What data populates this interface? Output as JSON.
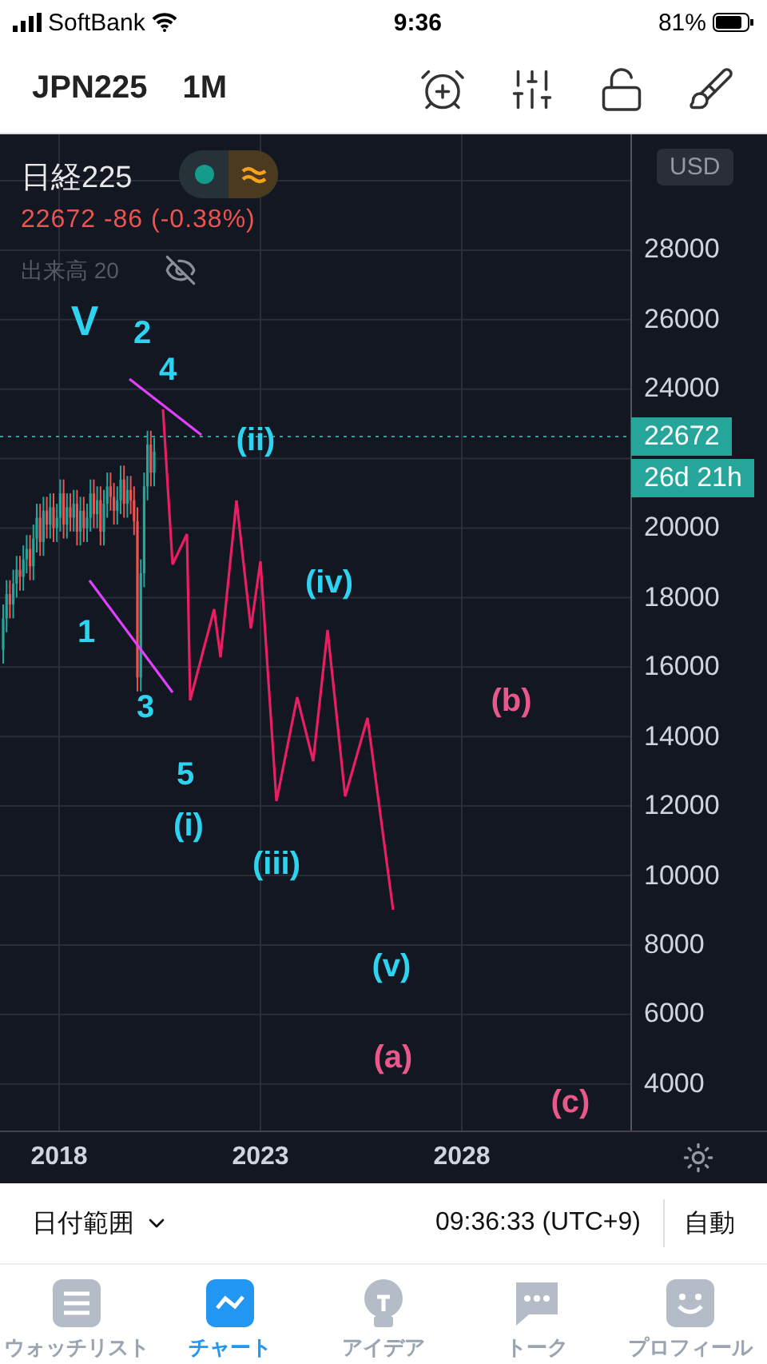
{
  "status_bar": {
    "carrier": "SoftBank",
    "time": "9:36",
    "battery": "81%"
  },
  "header": {
    "symbol": "JPN225",
    "interval": "1M"
  },
  "legend": {
    "name": "日経225",
    "price": "22672",
    "change": "-86 (-0.38%)",
    "volume": "出来高 20"
  },
  "currency": "USD",
  "price_axis": {
    "ticks": [
      "28000",
      "26000",
      "24000",
      "20000",
      "18000",
      "16000",
      "14000",
      "12000",
      "10000",
      "8000",
      "6000",
      "4000"
    ],
    "price_tag": "22672",
    "countdown": "26d 21h"
  },
  "time_axis": [
    "2018",
    "2023",
    "2028"
  ],
  "wave_labels": [
    {
      "text": "V",
      "color": "#2ed3f0"
    },
    {
      "text": "2",
      "color": "#2ed3f0"
    },
    {
      "text": "4",
      "color": "#2ed3f0"
    },
    {
      "text": "(ii)",
      "color": "#2ed3f0"
    },
    {
      "text": "1",
      "color": "#2ed3f0"
    },
    {
      "text": "(iv)",
      "color": "#2ed3f0"
    },
    {
      "text": "3",
      "color": "#2ed3f0"
    },
    {
      "text": "5",
      "color": "#2ed3f0"
    },
    {
      "text": "(i)",
      "color": "#2ed3f0"
    },
    {
      "text": "(iii)",
      "color": "#2ed3f0"
    },
    {
      "text": "(v)",
      "color": "#2ed3f0"
    },
    {
      "text": "(b)",
      "color": "#e8588a"
    },
    {
      "text": "(a)",
      "color": "#e8588a"
    },
    {
      "text": "(c)",
      "color": "#e8588a"
    }
  ],
  "footer": {
    "date_range": "日付範囲",
    "time": "09:36:33 (UTC+9)",
    "scale": "自動"
  },
  "tabs": [
    {
      "label": "ウォッチリスト",
      "selected": false
    },
    {
      "label": "チャート",
      "selected": true
    },
    {
      "label": "アイデア",
      "selected": false
    },
    {
      "label": "トーク",
      "selected": false
    },
    {
      "label": "プロフィール",
      "selected": false
    }
  ]
}
